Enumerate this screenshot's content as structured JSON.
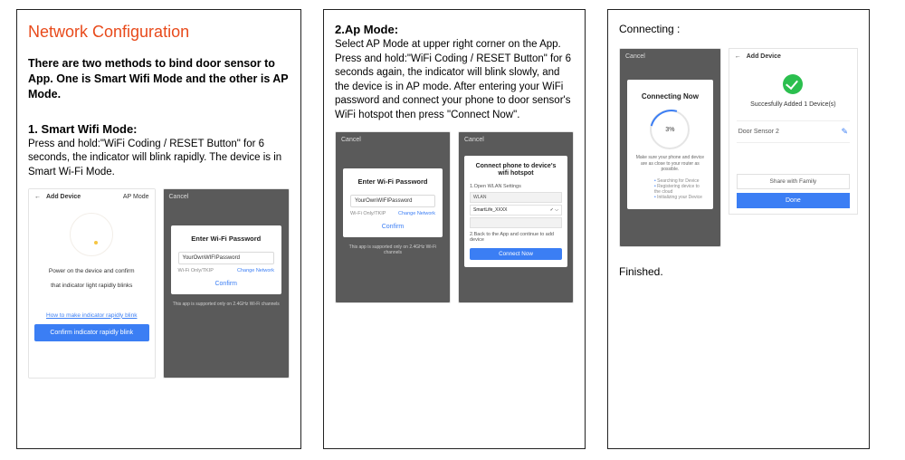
{
  "col1": {
    "title": "Network Configuration",
    "intro": "There are two methods to bind door sensor to App. One is Smart Wifi Mode and the other is AP Mode.",
    "sec_head": "1. Smart Wifi Mode:",
    "sec_body": "Press and hold:\"WiFi Coding / RESET Button\" for 6 seconds, the indicator will blink rapidly. The device is in Smart Wi-Fi Mode.",
    "phoneA": {
      "back": "←",
      "title": "Add Device",
      "right": "AP Mode",
      "line1": "Power on the device and confirm",
      "line2": "that indicator light rapidly blinks",
      "link": "How to make indicator rapidly blink",
      "btn": "Confirm indicator rapidly blink"
    },
    "phoneB": {
      "cancel": "Cancel",
      "card_title": "Enter Wi-Fi Password",
      "pwd": "YourOwnWIFIPassword",
      "only": "Wi-Fi Only/TKIP",
      "change": "Change Network",
      "confirm": "Confirm",
      "note": "This app is supported only on 2.4GHz Wi-Fi channels"
    }
  },
  "col2": {
    "sec_head": "2.Ap Mode:",
    "sec_body": "Select AP Mode at upper right corner on the App. Press and hold:\"WiFi Coding / RESET Button\" for 6 seconds again, the indicator will blink slowly, and the device is in AP mode. After entering your WiFi password and connect your phone to door sensor's WiFi hotspot then press \"Connect Now\".",
    "phoneA": {
      "cancel": "Cancel",
      "card_title": "Enter Wi-Fi Password",
      "pwd": "YourOwnWIFIPassword",
      "only": "Wi-Fi Only/TKIP",
      "change": "Change Network",
      "confirm": "Confirm",
      "note": "This app is supported only on 2.4GHz Wi-Fi channels"
    },
    "phoneB": {
      "cancel": "Cancel",
      "card_title": "Connect phone to device's wifi hotspot",
      "step1": "1.Open WLAN Settings",
      "wlan_a": "WLAN",
      "wlan_sel": "SmartLife_XXXX",
      "step2": "2.Back to the App and continue to add device",
      "btn": "Connect Now"
    }
  },
  "col3": {
    "connecting_label": "Connecting :",
    "phoneA": {
      "cancel": "Cancel",
      "card_title": "Connecting Now",
      "percent": "3%",
      "sub": "Make sure your phone and device are as close to your router as possible.",
      "b1": "Searching for Device",
      "b2": "Registering device to the cloud",
      "b3": "Initializing your Device"
    },
    "phoneB": {
      "back": "←",
      "title": "Add Device",
      "succ": "Succesfully Added 1 Device(s)",
      "device": "Door Sensor 2",
      "share": "Share with Family",
      "done": "Done"
    },
    "finished": "Finished."
  }
}
